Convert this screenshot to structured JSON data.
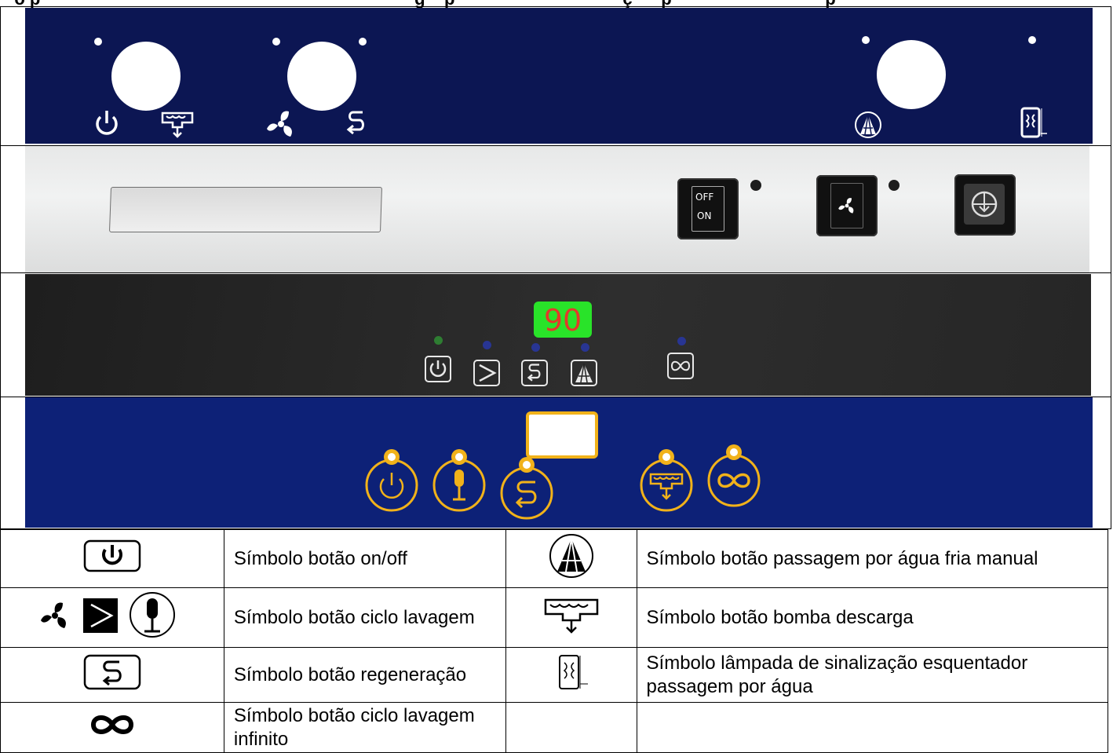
{
  "header": {
    "cropped_line": "   o p                                                                              g    p                                   ç      p                                p"
  },
  "panel3": {
    "display_value": "90"
  },
  "panel2": {
    "switch1_top": "OFF",
    "switch1_bottom": "ON"
  },
  "colors": {
    "panel1_bg": "#0c1653",
    "panel4_bg": "#0d2177",
    "accent_yellow": "#f1b21a",
    "display_green": "#29e329",
    "display_red": "#e23a2a"
  },
  "legend": {
    "rows": [
      {
        "left_icons": [
          "power-icon"
        ],
        "left_label": "Símbolo botão on/off",
        "right_icons": [
          "cold-water-rinse-icon"
        ],
        "right_label": "Símbolo botão passagem por água fria manual"
      },
      {
        "left_icons": [
          "fan-icon",
          "play-icon",
          "spray-arm-icon"
        ],
        "left_label": "Símbolo botão ciclo lavagem",
        "right_icons": [
          "drain-pump-icon"
        ],
        "right_label": "Símbolo botão bomba descarga"
      },
      {
        "left_icons": [
          "regeneration-icon"
        ],
        "left_label": "Símbolo botão regeneração",
        "right_icons": [
          "boiler-lamp-icon"
        ],
        "right_label": "Símbolo lâmpada de sinalização esquentador passagem por água"
      },
      {
        "left_icons": [
          "infinity-icon"
        ],
        "left_label": "Símbolo botão ciclo lavagem infinito",
        "right_icons": [],
        "right_label": ""
      }
    ]
  }
}
